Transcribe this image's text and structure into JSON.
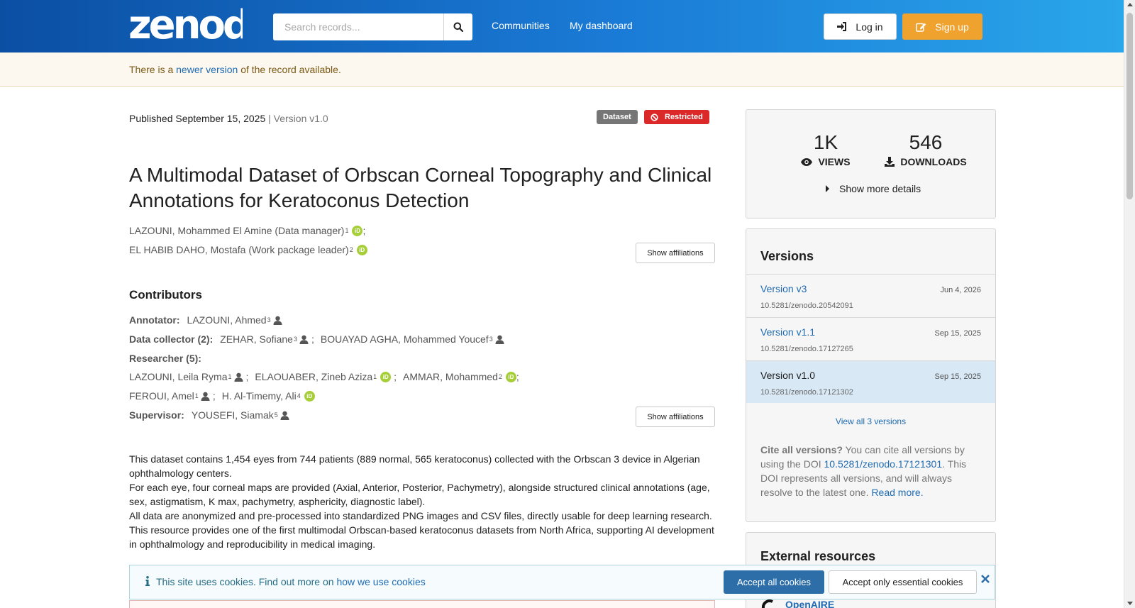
{
  "header": {
    "logo_text": "zenodo",
    "search_placeholder": "Search records...",
    "nav": [
      "Communities",
      "My dashboard"
    ],
    "login_label": "Log in",
    "signup_label": "Sign up"
  },
  "notice": {
    "prefix": "There is a",
    "link": "newer version",
    "suffix": "of the record available."
  },
  "record": {
    "published": "Published September 15, 2025",
    "version": "| Version v1.0",
    "badges": {
      "type": "Dataset",
      "access": "Restricted"
    },
    "title": "A Multimodal Dataset of Orbscan Corneal Topography and Clinical Annotations for Keratoconus Detection",
    "creators": [
      {
        "name": "LAZOUNI, Mohammed El Amine (Data manager)",
        "aff": "1",
        "sep": ";"
      },
      {
        "name": "EL HABIB DAHO, Mostafa (Work package leader)",
        "aff": "2",
        "sep": ""
      }
    ],
    "show_affiliations": "Show affiliations",
    "contributors_heading": "Contributors",
    "contributors": {
      "annotator": {
        "role": "Annotator:",
        "people": [
          {
            "name": "LAZOUNI, Ahmed",
            "aff": "3"
          }
        ]
      },
      "collector": {
        "role": "Data collector (2):",
        "people": [
          {
            "name": "ZEHAR, Sofiane",
            "aff": "3"
          },
          {
            "name": "BOUAYAD AGHA, Mohammed Youcef",
            "aff": "3"
          }
        ]
      },
      "researcher_role": "Researcher (5):",
      "researchers_row1": [
        {
          "name": "LAZOUNI, Leila Ryma",
          "aff": "1"
        },
        {
          "name": "ELAOUABER, Zineb Aziza",
          "aff": "1"
        },
        {
          "name": "AMMAR, Mohammed",
          "aff": "2"
        }
      ],
      "researchers_row2": [
        {
          "name": "FEROUI, Amel",
          "aff": "1"
        },
        {
          "name": "H. Al-Timemy, Ali",
          "aff": "4"
        }
      ],
      "supervisor": {
        "role": "Supervisor:",
        "people": [
          {
            "name": "YOUSEFI, Siamak",
            "aff": "5"
          }
        ]
      },
      "separator": ";",
      "orcid_label": "iD"
    },
    "description": [
      "This dataset contains 1,454 eyes from 744 patients (889 normal, 565 keratoconus) collected with the Orbscan 3 device in Algerian ophthalmology centers.",
      "For each eye, four corneal maps are provided (Axial, Anterior, Posterior, Pachymetry), alongside structured clinical annotations (age, sex, astigmatism, K max, pachymetry, asphericity, diagnostic label).",
      "All data are anonymized and pre-processed into standardized PNG images and CSV files, directly usable for deep learning research.",
      "This resource provides one of the first multimodal Orbscan-based keratoconus datasets from North Africa, supporting AI development in ophthalmology and reproducibility in medical imaging."
    ]
  },
  "stats": {
    "views": "1K",
    "views_label": "VIEWS",
    "downloads": "546",
    "downloads_label": "DOWNLOADS",
    "show_more": "Show more details"
  },
  "versions": {
    "heading": "Versions",
    "items": [
      {
        "name": "Version v3",
        "date": "Jun 4, 2026",
        "doi": "10.5281/zenodo.20542091"
      },
      {
        "name": "Version v1.1",
        "date": "Sep 15, 2025",
        "doi": "10.5281/zenodo.17127265"
      },
      {
        "name": "Version v1.0",
        "date": "Sep 15, 2025",
        "doi": "10.5281/zenodo.17121302"
      }
    ],
    "view_all": "View all 3 versions",
    "cite_bold": "Cite all versions?",
    "cite_text1": "You can cite all versions by using the DOI",
    "cite_doi": "10.5281/zenodo.17121301",
    "cite_text2": ". This DOI represents all versions, and will always resolve to the latest one.",
    "read_more": "Read more."
  },
  "external": {
    "heading": "External resources",
    "openaire": "OpenAIRE"
  },
  "cookie": {
    "text": "This site uses cookies. Find out more on",
    "link": "how we use cookies",
    "accept_all": "Accept all cookies",
    "accept_essential": "Accept only essential cookies"
  },
  "colors": {
    "header_start": "#0b4fa3",
    "header_end": "#2aa6ea",
    "signup": "#f0a22e",
    "dataset_badge": "#767676",
    "restricted_badge": "#db2828",
    "link": "#1f6bb3",
    "orcid": "#a6ce39"
  },
  "icons": {
    "search": "search-icon",
    "login": "sign-in-icon",
    "signup": "edit-icon",
    "restricted": "ban-icon",
    "views": "eye-icon",
    "downloads": "download-icon",
    "show_more": "caret-right-icon",
    "person": "user-icon",
    "orcid": "orcid-icon",
    "info": "info-icon",
    "close": "close-icon"
  }
}
